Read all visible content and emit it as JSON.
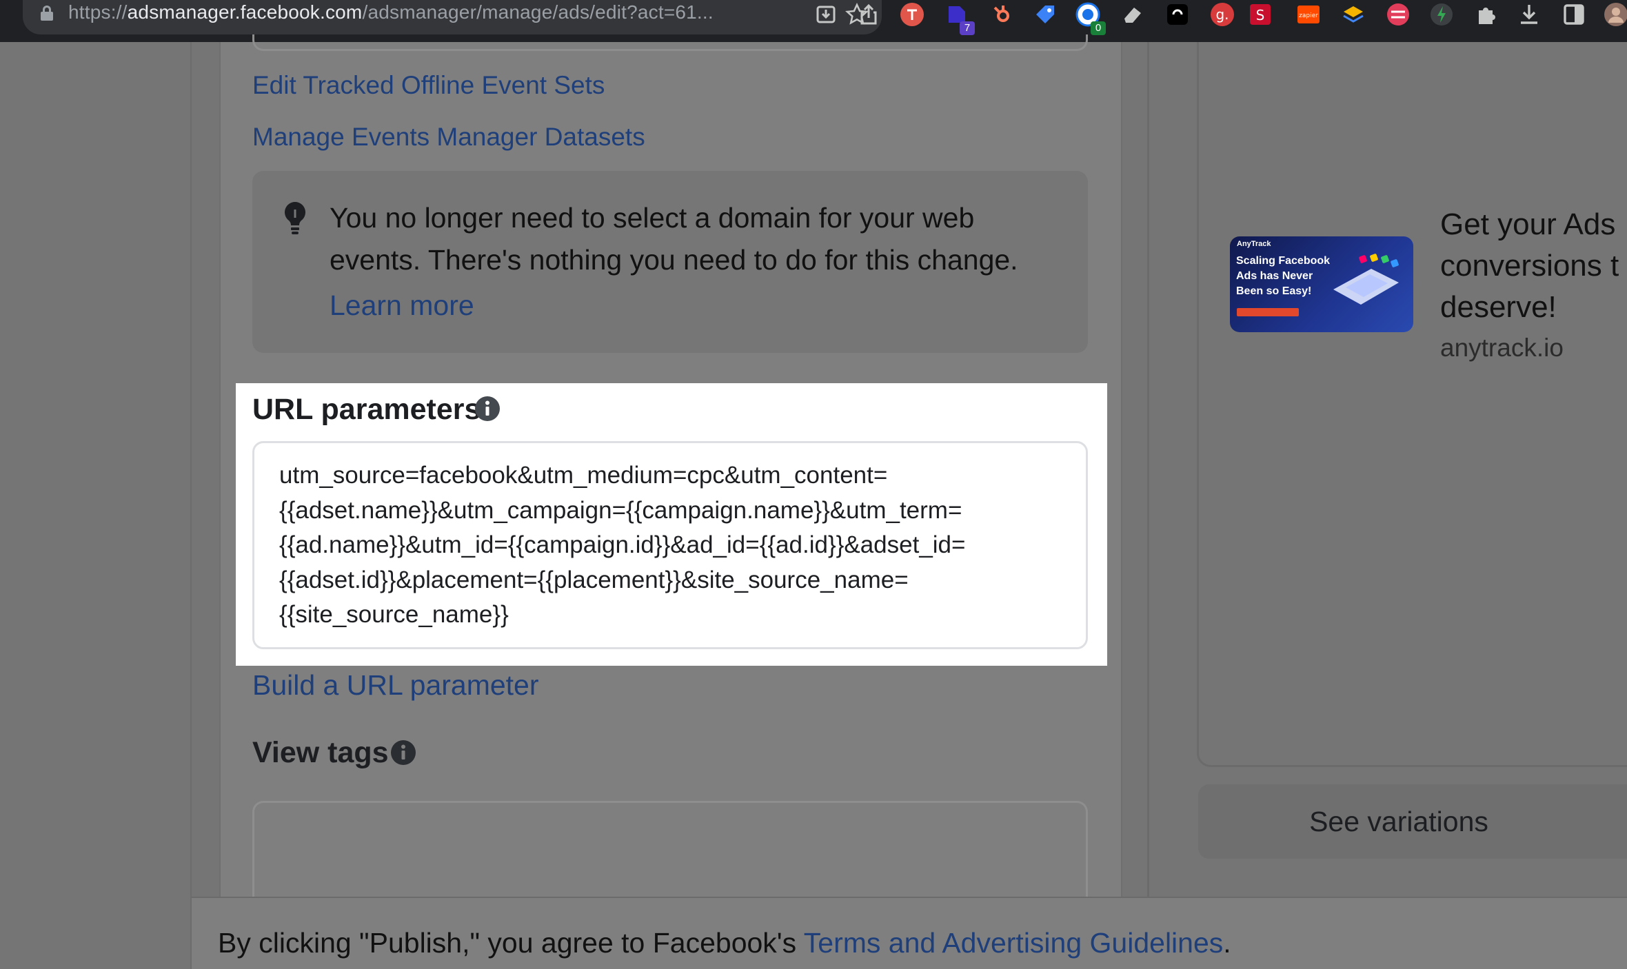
{
  "browser": {
    "url_prefix": "https://",
    "url_host": "adsmanager.facebook.com",
    "url_path": "/adsmanager/manage/ads/edit?act=61...",
    "extension_badges": {
      "seven": "7",
      "zero": "0"
    },
    "extension_labels": {
      "zapier": "zapier"
    }
  },
  "tracking": {
    "edit_offline_events_link": "Edit Tracked Offline Event Sets",
    "manage_datasets_link": "Manage Events Manager Datasets"
  },
  "notice": {
    "text": "You no longer need to select a domain for your web events. There's nothing you need to do for this change.",
    "learn_more": "Learn more"
  },
  "url_parameters": {
    "title": "URL parameters",
    "value": "utm_source=facebook&utm_medium=cpc&utm_content=\n{{adset.name}}&utm_campaign={{campaign.name}}&utm_term=\n{{ad.name}}&utm_id={{campaign.id}}&ad_id={{ad.id}}&adset_id=\n{{adset.id}}&placement={{placement}}&site_source_name=\n{{site_source_name}}",
    "build_link": "Build a URL parameter"
  },
  "view_tags": {
    "title": "View tags"
  },
  "preview": {
    "thumb_brand": "AnyTrack",
    "thumb_headline": "Scaling Facebook Ads has Never Been so Easy!",
    "headline_lines": [
      "Get your Ads",
      "conversions t",
      "deserve!"
    ],
    "domain": "anytrack.io",
    "see_variations": "See variations"
  },
  "footer": {
    "prefix": "By clicking \"Publish,\" you agree to Facebook's ",
    "terms_link": "Terms and Advertising Guidelines",
    "suffix": "."
  },
  "colors": {
    "link": "#1f3f7a",
    "highlight_panel": "#ffffff",
    "dimmed_overlay": "#7f7f7f",
    "browser_chrome": "#202124"
  }
}
